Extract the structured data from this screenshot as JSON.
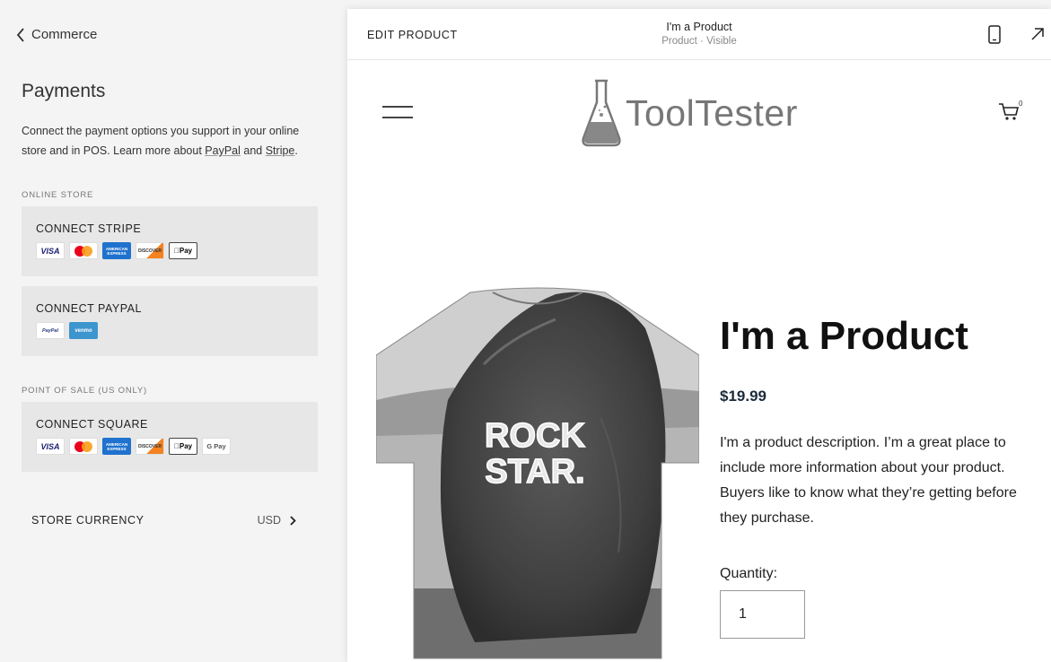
{
  "left_panel": {
    "back_label": "Commerce",
    "title": "Payments",
    "description": {
      "part1": "Connect the payment options you support in your online store and in POS. Learn more about ",
      "link_paypal": "PayPal",
      "part2": " and ",
      "link_stripe": "Stripe",
      "part3": "."
    },
    "online_store_label": "ONLINE STORE",
    "stripe": {
      "title": "CONNECT STRIPE",
      "badges": [
        "VISA",
        "mastercard",
        "AMERICAN EXPRESS",
        "DISCOVER",
        "Pay"
      ]
    },
    "paypal": {
      "title": "CONNECT PAYPAL",
      "badges": [
        "PayPal",
        "venmo"
      ]
    },
    "pos_label": "POINT OF SALE (US ONLY)",
    "square": {
      "title": "CONNECT SQUARE",
      "badges": [
        "VISA",
        "mastercard",
        "AMERICAN EXPRESS",
        "DISCOVER",
        "Pay",
        "G Pay"
      ]
    },
    "currency": {
      "label": "STORE CURRENCY",
      "value": "USD"
    }
  },
  "preview": {
    "edit_label": "EDIT PRODUCT",
    "page_name": "I'm a Product",
    "page_status": "Product · Visible",
    "logo_text": "ToolTester",
    "cart_count": "0",
    "product": {
      "name": "I'm a Product",
      "price": "$19.99",
      "description": "I'm a product description. I’m a great place to include more information about your product. Buyers like to know what they’re getting before they purchase.",
      "image_text_line1": "ROCK",
      "image_text_line2": "STAR.",
      "quantity_label": "Quantity:",
      "quantity_value": "1"
    }
  },
  "colors": {
    "panel_bg": "#f4f4f4",
    "card_bg": "#e7e7e7",
    "price_color": "#1b2b3a"
  }
}
